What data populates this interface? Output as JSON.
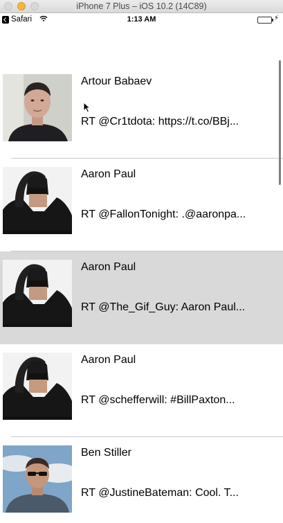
{
  "window": {
    "title": "iPhone 7 Plus – iOS 10.2 (14C89)"
  },
  "status_bar": {
    "back_app": "Safari",
    "time": "1:13 AM"
  },
  "tweets": [
    {
      "name": "Artour Babaev",
      "text": "RT @Cr1tdota: https://t.co/BBj...",
      "avatar": "artour-avatar"
    },
    {
      "name": "Aaron Paul",
      "text": "RT @FallonTonight: .@aaronpa...",
      "avatar": "aaron-avatar"
    },
    {
      "name": "Aaron Paul",
      "text": "RT @The_Gif_Guy: Aaron Paul...",
      "avatar": "aaron-avatar"
    },
    {
      "name": "Aaron Paul",
      "text": "RT @schefferwill: #BillPaxton...",
      "avatar": "aaron-avatar"
    },
    {
      "name": "Ben Stiller",
      "text": "RT @JustineBateman: Cool. T...",
      "avatar": "ben-avatar"
    }
  ],
  "colors": {
    "selected_row": "#d9d9d9",
    "separator": "#c8c7cc",
    "battery": "#34c84a"
  }
}
